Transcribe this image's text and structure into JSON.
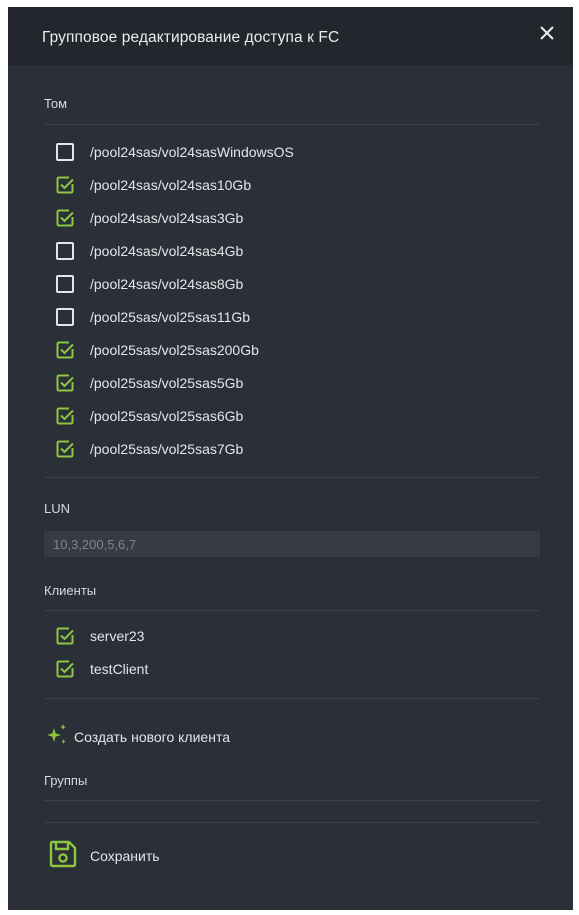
{
  "dialog": {
    "title": "Групповое редактирование доступа к FC",
    "close_icon": "close-icon"
  },
  "volumes": {
    "label": "Том",
    "items": [
      {
        "label": "/pool24sas/vol24sasWindowsOS",
        "checked": false
      },
      {
        "label": "/pool24sas/vol24sas10Gb",
        "checked": true
      },
      {
        "label": "/pool24sas/vol24sas3Gb",
        "checked": true
      },
      {
        "label": "/pool24sas/vol24sas4Gb",
        "checked": false
      },
      {
        "label": "/pool24sas/vol24sas8Gb",
        "checked": false
      },
      {
        "label": "/pool25sas/vol25sas11Gb",
        "checked": false
      },
      {
        "label": "/pool25sas/vol25sas200Gb",
        "checked": true
      },
      {
        "label": "/pool25sas/vol25sas5Gb",
        "checked": true
      },
      {
        "label": "/pool25sas/vol25sas6Gb",
        "checked": true
      },
      {
        "label": "/pool25sas/vol25sas7Gb",
        "checked": true
      }
    ]
  },
  "lun": {
    "label": "LUN",
    "placeholder": "10,3,200,5,6,7"
  },
  "clients": {
    "label": "Клиенты",
    "items": [
      {
        "label": "server23",
        "checked": true
      },
      {
        "label": "testClient",
        "checked": true
      }
    ]
  },
  "create_client": {
    "label": "Создать нового клиента",
    "icon": "sparkle-icon"
  },
  "groups": {
    "label": "Группы"
  },
  "save": {
    "label": "Сохранить",
    "icon": "save-icon"
  },
  "colors": {
    "background": "#2b2f37",
    "header": "#23262d",
    "accent_green": "#8dc63f",
    "text": "#e4e6ea"
  }
}
